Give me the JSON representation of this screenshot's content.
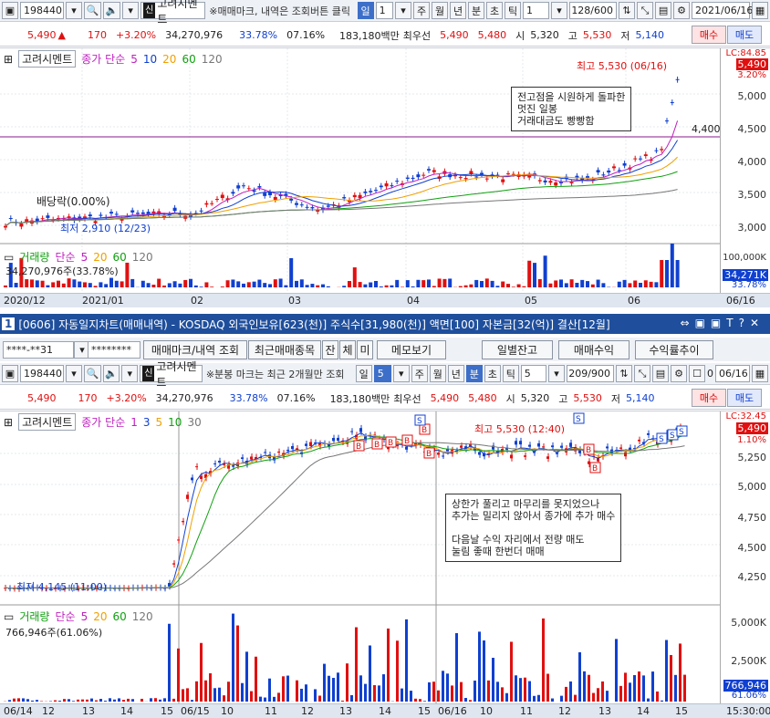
{
  "top": {
    "code": "198440",
    "sin_badge": "신",
    "name": "고려시멘트",
    "hint": "※매매마크, 내역은 조회버튼 클릭",
    "period_sel": "일",
    "period_n": "1",
    "tabs": [
      "주",
      "월",
      "년",
      "분",
      "초",
      "틱"
    ],
    "tick_n": "1",
    "count": "128/600",
    "date": "2021/06/16"
  },
  "quote": {
    "price": "5,490",
    "arrow": "▲",
    "change": "170",
    "pct": "+3.20%",
    "volume": "34,270,976",
    "turnover": "33.78%",
    "ratio": "07.16%",
    "amount": "183,180백만",
    "best_label": "최우선",
    "best_ask": "5,490",
    "best_bid": "5,480",
    "open_label": "시",
    "open": "5,320",
    "high_label": "고",
    "high": "5,530",
    "low_label": "저",
    "low": "5,140",
    "buy": "매수",
    "sell": "매도"
  },
  "chart1": {
    "name": "고려시멘트",
    "ma_label": "종가 단순",
    "ma": [
      "5",
      "10",
      "20",
      "60",
      "120"
    ],
    "lc": "LC:84.85",
    "price_tag": "5,490",
    "pct_tag": "3.20%",
    "y_ticks": [
      "5,000",
      "4,500",
      "4,000",
      "3,500",
      "3,000"
    ],
    "high_label": "최고 5,530 (06/16)",
    "low_label": "최저 2,910 (12/23)",
    "div_label": "배당락(0.00%)",
    "line_label": "4,400",
    "note": "전고점을 시원하게 돌파한\n멋진 일봉\n거래대금도 빵빵함",
    "vol_label": "거래량",
    "vol_ma_label": "단순",
    "vol_ma": [
      "5",
      "20",
      "60",
      "120"
    ],
    "vol_value": "34,270,976주(33.78%)",
    "vol_y": "100,000K",
    "vol_tag": "34,271K",
    "vol_pct": "33.78%",
    "x_ticks": [
      "2020/12",
      "2021/01",
      "02",
      "03",
      "04",
      "05",
      "06",
      "06/16"
    ]
  },
  "window": {
    "title": "[0606] 자동일지차트(매매내역) - KOSDAQ 외국인보유[623(천)] 주식수[31,980(천)] 액면[100] 자본금[32(억)] 결산[12월]",
    "num": "1",
    "account": "****-**31",
    "password": "********",
    "buttons": [
      "매매마크/내역 조회",
      "최근매매종목",
      "잔",
      "체",
      "미",
      "메모보기",
      "일별잔고",
      "매매수익",
      "수익률추이"
    ]
  },
  "top2": {
    "code": "198440",
    "sin_badge": "신",
    "name": "고려시멘트",
    "hint": "※분봉 마크는 최근 2개월만 조회",
    "period_sel": "일",
    "period_n": "5",
    "tabs": [
      "주",
      "월",
      "년",
      "분",
      "초",
      "틱"
    ],
    "min_n": "5",
    "count": "209/900",
    "check": "0",
    "date": "06/16"
  },
  "chart2": {
    "name": "고려시멘트",
    "ma_label": "종가 단순",
    "ma": [
      "1",
      "3",
      "5",
      "10",
      "30"
    ],
    "lc": "LC:32.45",
    "price_tag": "5,490",
    "pct_tag": "1.10%",
    "y_ticks": [
      "5,250",
      "5,000",
      "4,750",
      "4,500",
      "4,250"
    ],
    "high_label": "최고 5,530 (12:40)",
    "low_label": "최저 4,145 (11:00)",
    "note": "상한가 풀리고 마무리를 못지었으나\n추가는 밀리지 않아서 종가에 추가 매수\n\n다음날 수익 자리에서 전량 매도\n눌림 좋때 한번더 매매",
    "vol_label": "거래량",
    "vol_ma_label": "단순",
    "vol_ma": [
      "5",
      "20",
      "60",
      "120"
    ],
    "vol_value": "766,946주(61.06%)",
    "vol_y": [
      "5,000K",
      "2,500K"
    ],
    "vol_tag": "766,946",
    "vol_pct": "61.06%",
    "x_ticks": [
      "06/14",
      "12",
      "13",
      "14",
      "15",
      "06/15",
      "10",
      "11",
      "12",
      "13",
      "14",
      "15",
      "06/16",
      "10",
      "11",
      "12",
      "13",
      "14",
      "15",
      "15:30:00"
    ]
  },
  "colors": {
    "up": "#e01010",
    "down": "#1040d0",
    "ma5": "#c020c0",
    "ma10": "#1040d0",
    "ma20": "#f0a000",
    "ma60": "#10a010",
    "ma120": "#777777"
  }
}
